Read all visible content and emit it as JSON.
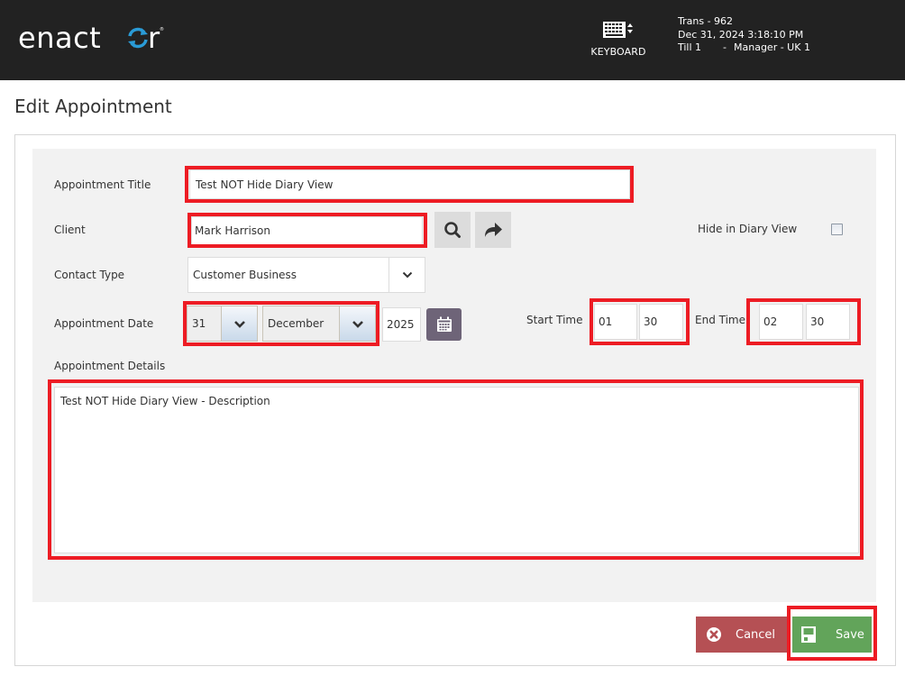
{
  "header": {
    "logo_text": "enactor",
    "keyboard_label": "KEYBOARD",
    "trans": "Trans - 962",
    "datetime": "Dec 31, 2024 3:18:10 PM",
    "till": "Till 1",
    "separator": "-",
    "user": "Manager - UK 1"
  },
  "page": {
    "title": "Edit Appointment"
  },
  "form": {
    "appointment_title": {
      "label": "Appointment Title",
      "value": "Test NOT Hide Diary View"
    },
    "client": {
      "label": "Client",
      "value": "Mark Harrison"
    },
    "hide_in_diary": {
      "label": "Hide in Diary View",
      "checked": false
    },
    "contact_type": {
      "label": "Contact Type",
      "value": "Customer Business"
    },
    "appointment_date": {
      "label": "Appointment Date",
      "day": "31",
      "month": "December",
      "year": "2025"
    },
    "start_time": {
      "label": "Start Time",
      "hour": "01",
      "minute": "30"
    },
    "end_time": {
      "label": "End Time",
      "hour": "02",
      "minute": "30"
    },
    "details": {
      "label": "Appointment Details",
      "value": "Test NOT Hide Diary View - Description"
    }
  },
  "buttons": {
    "cancel": "Cancel",
    "save": "Save"
  },
  "colors": {
    "header_bg": "#222222",
    "logo_accent": "#2a9bd6",
    "highlight": "#ed1c24",
    "cancel_bg": "#b55054",
    "save_bg": "#62a45a",
    "calendar_btn": "#6e6478"
  }
}
